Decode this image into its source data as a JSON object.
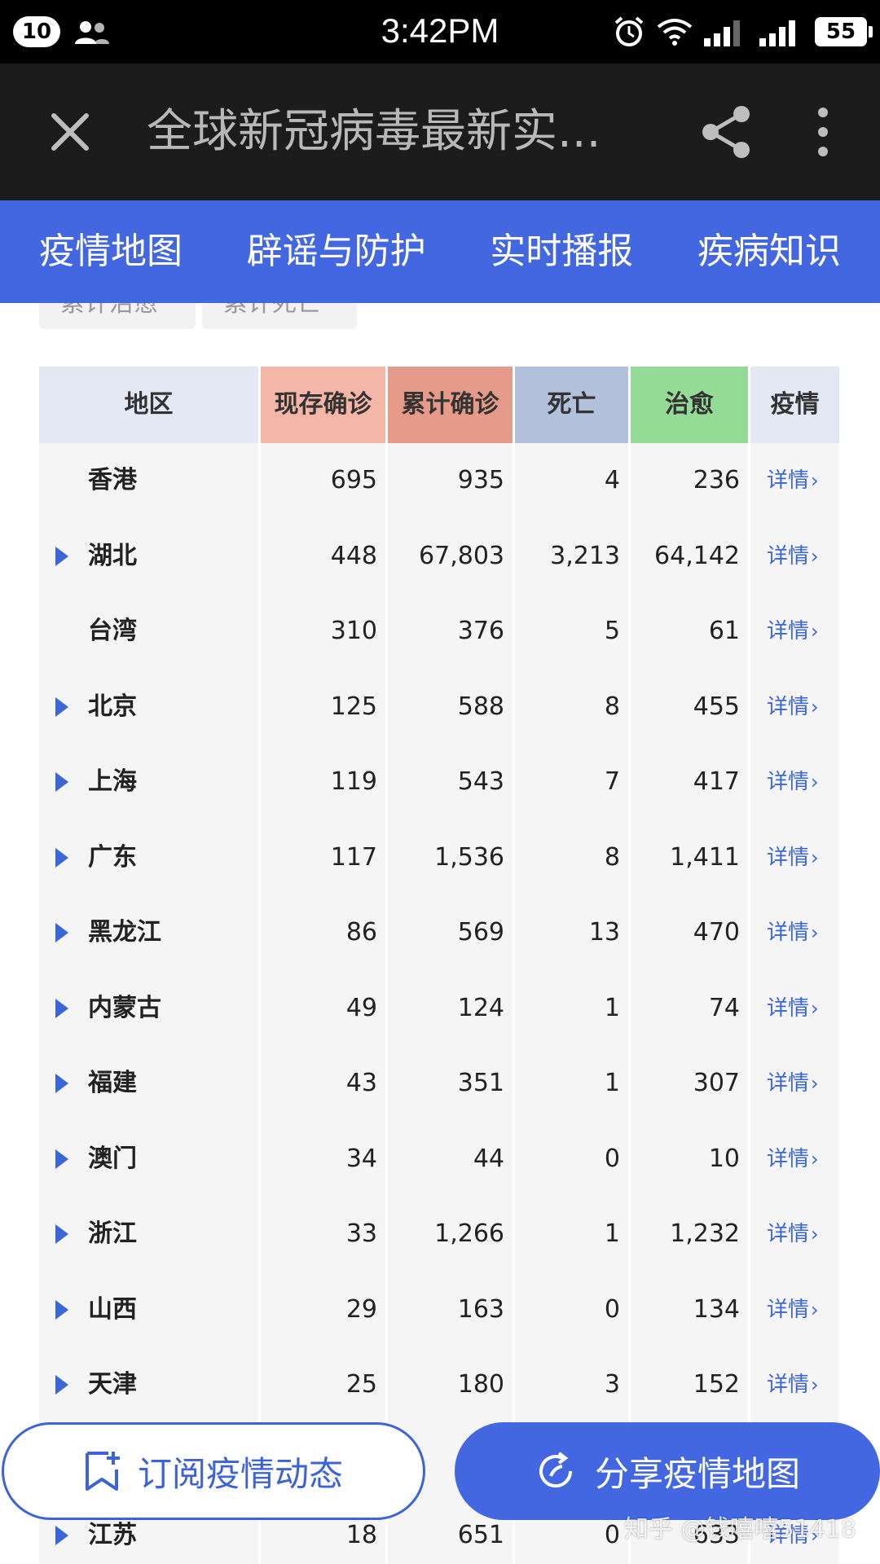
{
  "status_bar": {
    "notification_count": "10",
    "time": "3:42PM",
    "battery": "55"
  },
  "title_bar": {
    "title": "全球新冠病毒最新实..."
  },
  "tabs": [
    {
      "label": "疫情地图"
    },
    {
      "label": "辟谣与防护"
    },
    {
      "label": "实时播报"
    },
    {
      "label": "疾病知识"
    }
  ],
  "chips": [
    {
      "label": "累计治愈"
    },
    {
      "label": "累计死亡"
    }
  ],
  "table": {
    "headers": {
      "region": "地区",
      "current": "现存确诊",
      "total": "累计确诊",
      "death": "死亡",
      "cured": "治愈",
      "detail": "疫情"
    },
    "detail_label": "详情",
    "rows": [
      {
        "region": "香港",
        "expandable": false,
        "current": "695",
        "total": "935",
        "death": "4",
        "cured": "236"
      },
      {
        "region": "湖北",
        "expandable": true,
        "current": "448",
        "total": "67,803",
        "death": "3,213",
        "cured": "64,142"
      },
      {
        "region": "台湾",
        "expandable": false,
        "current": "310",
        "total": "376",
        "death": "5",
        "cured": "61"
      },
      {
        "region": "北京",
        "expandable": true,
        "current": "125",
        "total": "588",
        "death": "8",
        "cured": "455"
      },
      {
        "region": "上海",
        "expandable": true,
        "current": "119",
        "total": "543",
        "death": "7",
        "cured": "417"
      },
      {
        "region": "广东",
        "expandable": true,
        "current": "117",
        "total": "1,536",
        "death": "8",
        "cured": "1,411"
      },
      {
        "region": "黑龙江",
        "expandable": true,
        "current": "86",
        "total": "569",
        "death": "13",
        "cured": "470"
      },
      {
        "region": "内蒙古",
        "expandable": true,
        "current": "49",
        "total": "124",
        "death": "1",
        "cured": "74"
      },
      {
        "region": "福建",
        "expandable": true,
        "current": "43",
        "total": "351",
        "death": "1",
        "cured": "307"
      },
      {
        "region": "澳门",
        "expandable": true,
        "current": "34",
        "total": "44",
        "death": "0",
        "cured": "10"
      },
      {
        "region": "浙江",
        "expandable": true,
        "current": "33",
        "total": "1,266",
        "death": "1",
        "cured": "1,232"
      },
      {
        "region": "山西",
        "expandable": true,
        "current": "29",
        "total": "163",
        "death": "0",
        "cured": "134"
      },
      {
        "region": "天津",
        "expandable": true,
        "current": "25",
        "total": "180",
        "death": "3",
        "cured": "152"
      },
      {
        "region": "",
        "expandable": false,
        "current": "",
        "total": "",
        "death": "",
        "cured": ""
      },
      {
        "region": "江苏",
        "expandable": true,
        "current": "18",
        "total": "651",
        "death": "0",
        "cured": "633"
      }
    ]
  },
  "bottom": {
    "subscribe_label": "订阅疫情动态",
    "share_label": "分享疫情地图"
  },
  "watermark": "知乎 @钱嘻嘻51418",
  "colors": {
    "accent": "#4267e0",
    "header_current": "#f4b6a6",
    "header_total": "#e69a89",
    "header_death": "#b3c0dc",
    "header_cured": "#95db97",
    "link": "#3b66d8"
  }
}
